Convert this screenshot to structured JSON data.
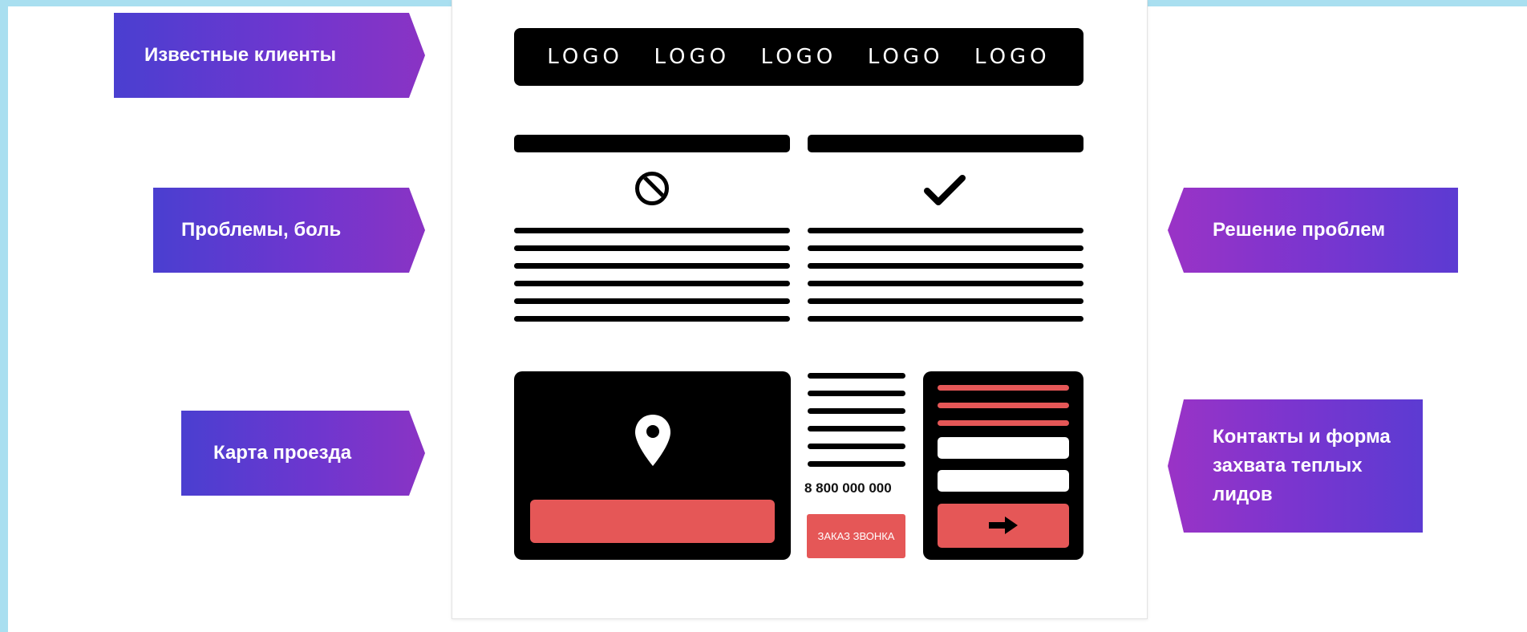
{
  "logos": [
    "LOGO",
    "LOGO",
    "LOGO",
    "LOGO",
    "LOGO"
  ],
  "labels": {
    "clients": "Известные клиенты",
    "problems": "Проблемы, боль",
    "map": "Карта проезда",
    "solution": "Решение проблем",
    "contacts": "Контакты и форма захвата теплых лидов"
  },
  "contact": {
    "phone": "8 800 000 000",
    "callback_button": "ЗАКАЗ ЗВОНКА"
  },
  "icons": {
    "problems": "prohibited-icon",
    "solution": "checkmark-icon",
    "map": "location-pin-icon",
    "submit": "arrow-right-icon"
  },
  "colors": {
    "accent_red": "#e55757",
    "tag_gradient_start": "#4a3fd0",
    "tag_gradient_end": "#8a33c4",
    "edge_blue": "#a9dff0"
  }
}
